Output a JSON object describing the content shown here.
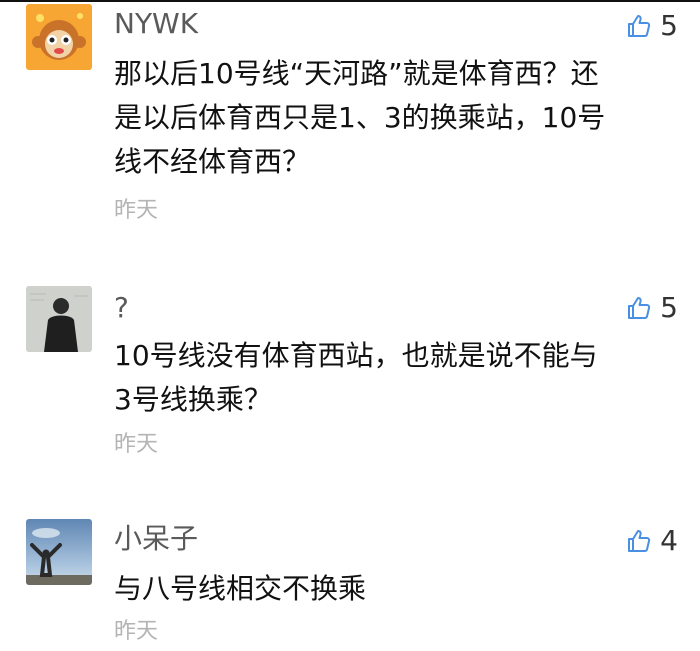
{
  "comments": [
    {
      "user": "NYWK",
      "likes": "5",
      "lines": [
        "那以后10号线“天河路”就是体育西？还",
        "是以后体育西只是1、3的换乘站，10号",
        "线不经体育西？"
      ],
      "time": "昨天",
      "avatar": "cartoon-monkey-avatar"
    },
    {
      "user": "?",
      "likes": "5",
      "lines": [
        "10号线没有体育西站，也就是说不能与",
        "3号线换乘？"
      ],
      "time": "昨天",
      "avatar": "person-photo-avatar"
    },
    {
      "user": "小呆子",
      "likes": "4",
      "lines": [
        "与八号线相交不换乘"
      ],
      "time": "昨天",
      "avatar": "sky-photo-avatar"
    }
  ],
  "colors": {
    "like_icon": "#4a90e2",
    "name": "#5a5a5a",
    "time": "#b4b4b4"
  },
  "icons": {
    "like": "thumbs-up-icon"
  }
}
